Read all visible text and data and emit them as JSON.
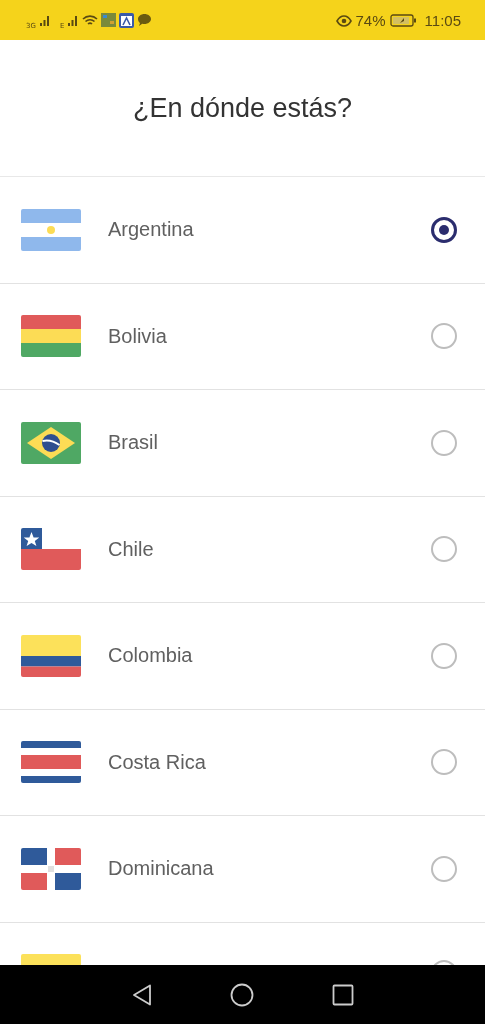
{
  "status_bar": {
    "network_1": "3G",
    "network_2": "E",
    "battery": "74%",
    "time": "11:05"
  },
  "title": "¿En dónde estás?",
  "countries": [
    {
      "name": "Argentina",
      "kind": "argentina",
      "selected": true
    },
    {
      "name": "Bolivia",
      "kind": "bolivia",
      "selected": false
    },
    {
      "name": "Brasil",
      "kind": "brasil",
      "selected": false
    },
    {
      "name": "Chile",
      "kind": "chile",
      "selected": false
    },
    {
      "name": "Colombia",
      "kind": "colombia",
      "selected": false
    },
    {
      "name": "Costa Rica",
      "kind": "costa-rica",
      "selected": false
    },
    {
      "name": "Dominicana",
      "kind": "dominicana",
      "selected": false
    },
    {
      "kind": "partial",
      "selected": false
    }
  ]
}
